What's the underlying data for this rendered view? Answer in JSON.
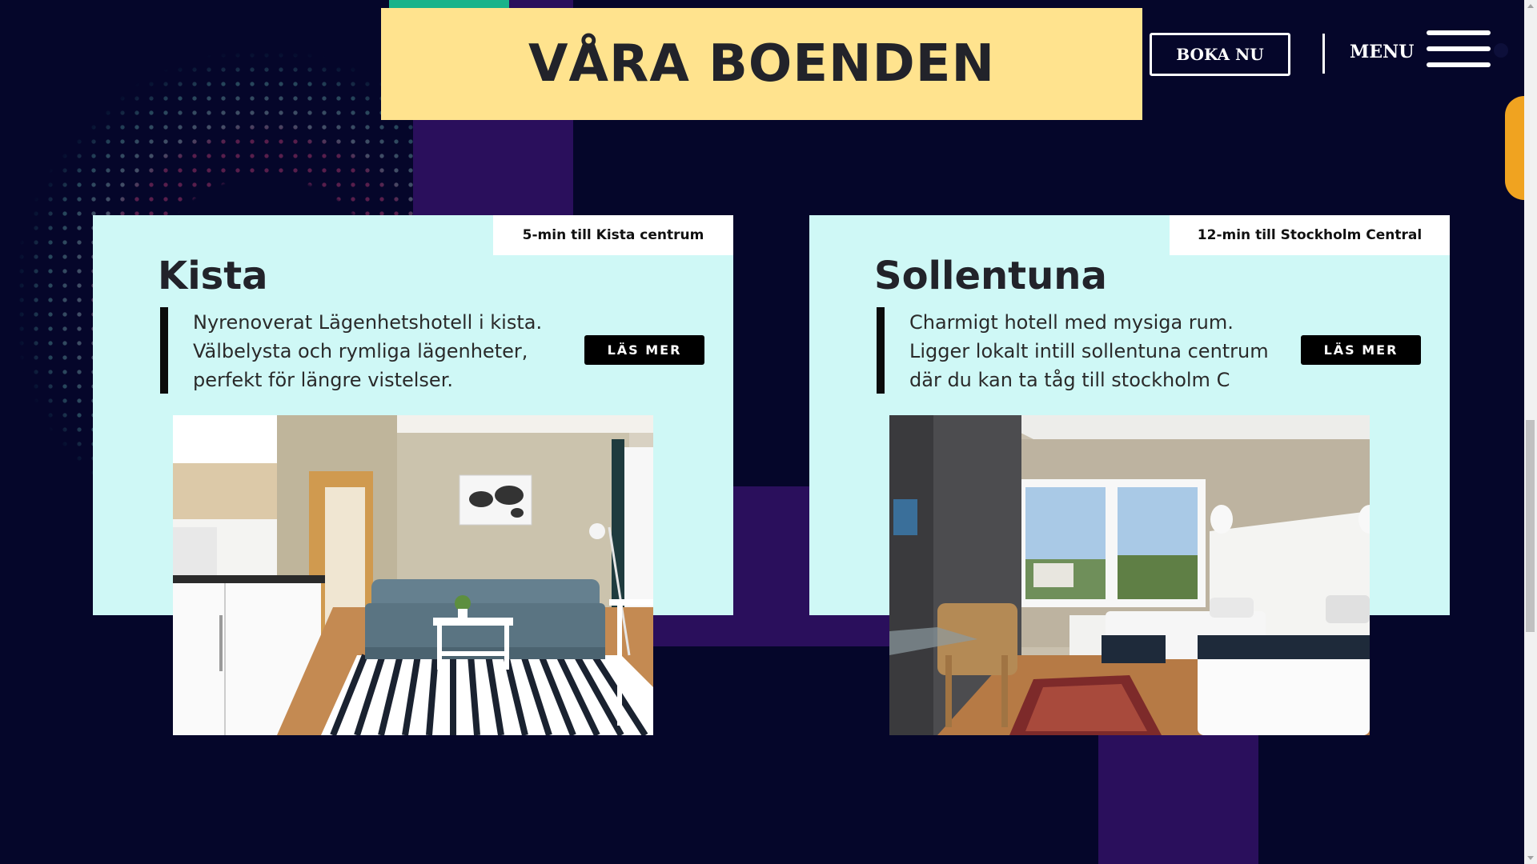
{
  "header": {
    "title": "VÅRA BOENDEN",
    "book_button": "BOKA NU",
    "menu_label": "MENU"
  },
  "icons": {
    "menu": "hamburger-menu-icon"
  },
  "colors": {
    "background": "#05062a",
    "title_block": "#ffe38e",
    "card": "#cff8f6",
    "accent_purple": "#2a0f5c",
    "accent_teal": "#19b38a",
    "accent_orange": "#f0a320"
  },
  "cards": [
    {
      "tag": "5-min till Kista centrum",
      "title": "Kista",
      "lines": [
        "Nyrenoverat Lägenhetshotell i kista.",
        "Välbelysta och rymliga lägenheter,",
        "perfekt för längre vistelser."
      ],
      "button": "LÄS MER"
    },
    {
      "tag": "12-min till Stockholm Central",
      "title": "Sollentuna",
      "lines": [
        "Charmigt hotell med mysiga rum.",
        "Ligger lokalt intill sollentuna centrum",
        "där du kan ta tåg till stockholm C"
      ],
      "button": "LÄS MER"
    }
  ]
}
